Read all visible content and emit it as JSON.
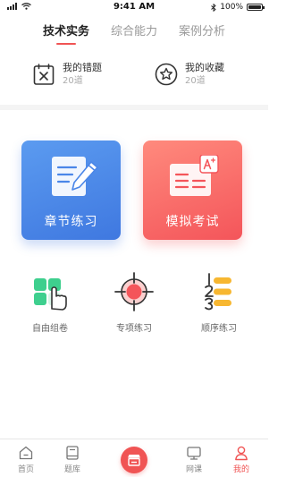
{
  "status_bar": {
    "time": "9:41 AM",
    "battery": "100%",
    "icons": [
      "signal-icon",
      "wifi-icon",
      "bluetooth-icon",
      "battery-icon"
    ]
  },
  "tabs": [
    {
      "label": "技术实务",
      "active": true
    },
    {
      "label": "综合能力",
      "active": false
    },
    {
      "label": "案例分析",
      "active": false
    }
  ],
  "quick": [
    {
      "title": "我的错题",
      "count": "20道",
      "icon": "wrong-question-icon"
    },
    {
      "title": "我的收藏",
      "count": "20道",
      "icon": "favorite-star-icon"
    }
  ],
  "cards": [
    {
      "label": "章节练习",
      "icon": "chapter-notebook-icon",
      "color": "#4a86e8"
    },
    {
      "label": "模拟考试",
      "icon": "exam-paper-icon",
      "color": "#f4555a"
    }
  ],
  "modes": [
    {
      "label": "自由组卷",
      "icon": "free-compose-icon"
    },
    {
      "label": "专项练习",
      "icon": "target-icon"
    },
    {
      "label": "顺序练习",
      "icon": "sequence-123-icon"
    }
  ],
  "tabbar": [
    {
      "label": "首页",
      "icon": "home-icon",
      "active": false
    },
    {
      "label": "题库",
      "icon": "book-icon",
      "active": false
    },
    {
      "label": "",
      "icon": "store-icon",
      "active": false
    },
    {
      "label": "网课",
      "icon": "monitor-icon",
      "active": false
    },
    {
      "label": "我的",
      "icon": "profile-icon",
      "active": true
    }
  ],
  "colors": {
    "accent": "#f05454",
    "blue": "#4a86e8",
    "red": "#f4555a"
  }
}
